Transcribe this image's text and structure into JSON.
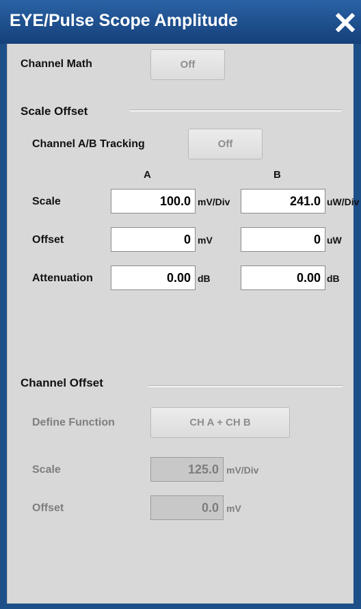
{
  "window": {
    "title": "EYE/Pulse Scope Amplitude",
    "close_icon": "close-icon"
  },
  "channel_math": {
    "label": "Channel Math",
    "button": "Off"
  },
  "scale_offset": {
    "heading": "Scale Offset",
    "tracking_label": "Channel A/B Tracking",
    "tracking_button": "Off",
    "col_a": "A",
    "col_b": "B",
    "rows": [
      {
        "label": "Scale",
        "a_value": "100.0",
        "a_unit": "mV/Div",
        "b_value": "241.0",
        "b_unit": "uW/Div"
      },
      {
        "label": "Offset",
        "a_value": "0",
        "a_unit": "mV",
        "b_value": "0",
        "b_unit": "uW"
      },
      {
        "label": "Attenuation",
        "a_value": "0.00",
        "a_unit": "dB",
        "b_value": "0.00",
        "b_unit": "dB"
      }
    ]
  },
  "channel_offset": {
    "heading": "Channel Offset",
    "define_label": "Define Function",
    "define_button": "CH A + CH B",
    "scale_label": "Scale",
    "scale_value": "125.0",
    "scale_unit": "mV/Div",
    "offset_label": "Offset",
    "offset_value": "0.0",
    "offset_unit": "mV"
  },
  "colors": {
    "title_bar": "#1d4f89",
    "panel": "#d8d8d8"
  }
}
